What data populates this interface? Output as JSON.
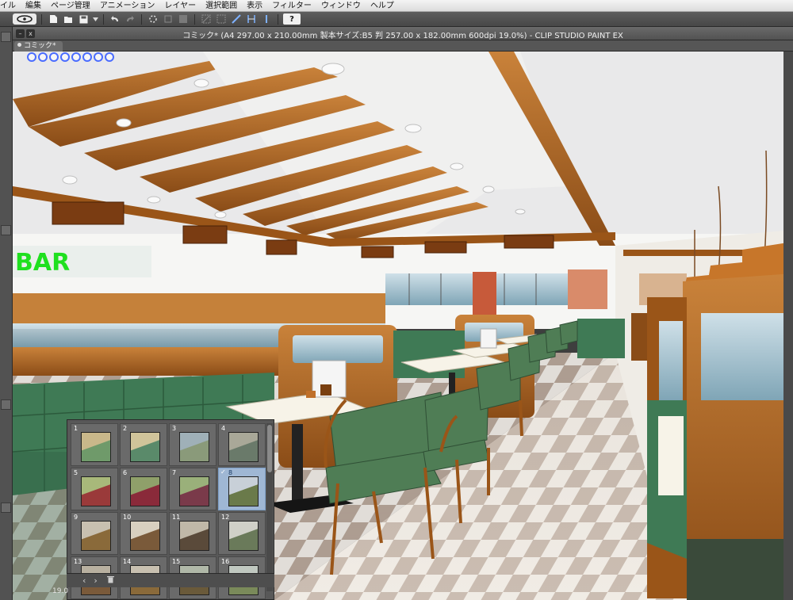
{
  "menu": [
    "イル",
    "編集",
    "ページ管理",
    "アニメーション",
    "レイヤー",
    "選択範囲",
    "表示",
    "フィルター",
    "ウィンドウ",
    "ヘルプ"
  ],
  "window": {
    "title": "コミック* (A4 297.00 x 210.00mm 製本サイズ:B5 判 257.00 x 182.00mm 600dpi 19.0%)  - CLIP STUDIO PAINT EX",
    "tab": "コミック*",
    "minimize_glyph": "–",
    "close_glyph": "x"
  },
  "toolbar": {
    "help_label": "?"
  },
  "scene": {
    "sign_text": "BAR"
  },
  "navigator": {
    "pages": [
      "1",
      "2",
      "3",
      "4",
      "5",
      "6",
      "7",
      "8",
      "9",
      "10",
      "11",
      "12",
      "13",
      "14",
      "15",
      "16"
    ],
    "selected_page": "8",
    "zoom": "19.0",
    "prev_glyph": "‹",
    "next_glyph": "›"
  },
  "colors": {
    "ceiling_wood": "#b5681f",
    "bench_green": "#3f7a55",
    "sign_green": "#1fe01f",
    "selection_blue": "#9fb7d4"
  }
}
